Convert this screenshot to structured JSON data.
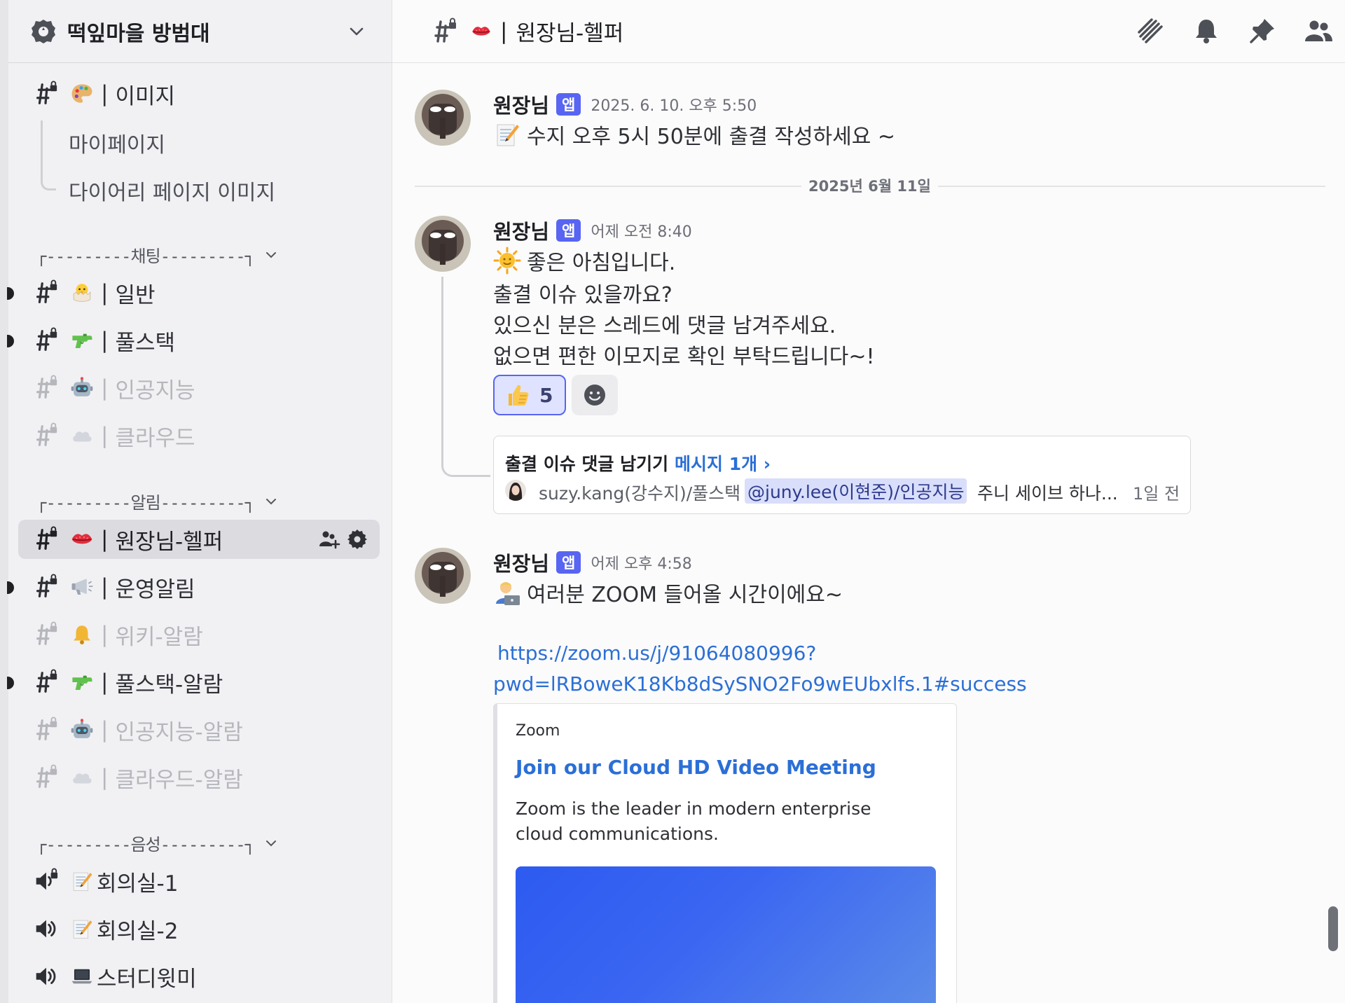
{
  "server": {
    "name": "떡잎마을 방범대"
  },
  "sidebar": {
    "items": [
      {
        "label": "이미지",
        "style": "normal"
      },
      {
        "label": "마이페이지"
      },
      {
        "label": "다이어리 페이지 이미지"
      }
    ],
    "categories": [
      {
        "label": "┌---------채팅---------┐"
      },
      {
        "label": "┌---------알림---------┐"
      },
      {
        "label": "┌---------음성---------┐"
      }
    ],
    "chat_channels": [
      {
        "label": "일반",
        "icon": "hatching-chick-icon",
        "unread": true
      },
      {
        "label": "풀스택",
        "icon": "water-pistol-icon",
        "unread": true
      },
      {
        "label": "인공지능",
        "icon": "robot-icon",
        "muted": true
      },
      {
        "label": "클라우드",
        "icon": "cloud-icon",
        "muted": true
      }
    ],
    "alert_channels": [
      {
        "label": "원장님-헬퍼",
        "icon": "kiss-mark-icon",
        "active": true
      },
      {
        "label": "운영알림",
        "icon": "megaphone-icon",
        "unread": true
      },
      {
        "label": "위키-알람",
        "icon": "bell-icon",
        "muted": true
      },
      {
        "label": "풀스택-알람",
        "icon": "water-pistol-icon",
        "unread": true
      },
      {
        "label": "인공지능-알람",
        "icon": "robot-icon",
        "muted": true
      },
      {
        "label": "클라우드-알람",
        "icon": "cloud-icon",
        "muted": true
      }
    ],
    "voice_channels": [
      {
        "label": "회의실-1",
        "icon": "memo-icon"
      },
      {
        "label": "회의실-2",
        "icon": "memo-icon"
      },
      {
        "label": "스터디윗미",
        "icon": "laptop-icon"
      }
    ],
    "separator": "|"
  },
  "channel": {
    "title": "원장님-헬퍼",
    "separator": "|"
  },
  "messages": [
    {
      "author": "원장님",
      "badge": "앱",
      "time": "2025. 6. 10. 오후 5:50",
      "lines": [
        "수지 오후 5시 50분에 출결 작성하세요 ~"
      ]
    },
    {
      "author": "원장님",
      "badge": "앱",
      "time": "어제 오전 8:40",
      "lines": [
        "좋은 아침입니다.",
        "출결 이슈 있을까요?",
        "있으신 분은 스레드에 댓글 남겨주세요.",
        "없으면 편한 이모지로 확인 부탁드립니다~!"
      ],
      "reaction": {
        "emoji": "thumbs-up-icon",
        "count": "5"
      },
      "thread": {
        "name": "출결 이슈 댓글 남기기",
        "count": "메시지 1개 ›",
        "user": "suzy.kang(강수지)/풀스택",
        "mention": "@juny.lee(이현준)/인공지능",
        "text": "주니 세이브 하나...",
        "ago": "1일 전"
      }
    },
    {
      "author": "원장님",
      "badge": "앱",
      "time": "어제 오후 4:58",
      "lines": [
        "여러분 ZOOM 들어올 시간이에요~"
      ],
      "link_line1": "https://zoom.us/j/91064080996?",
      "link_line2": "pwd=lRBoweK18Kb8dSySNO2Fo9wEUbxlfs.1#success",
      "embed": {
        "provider": "Zoom",
        "title": "Join our Cloud HD Video Meeting",
        "description": "Zoom is the leader in modern enterprise cloud communications."
      }
    }
  ],
  "date_divider": "2025년 6월 11일",
  "colors": {
    "accent": "#5865f2",
    "link": "#2b6fd6",
    "sidebar_bg": "#f1f1f3",
    "main_bg": "#fbfbfb"
  }
}
